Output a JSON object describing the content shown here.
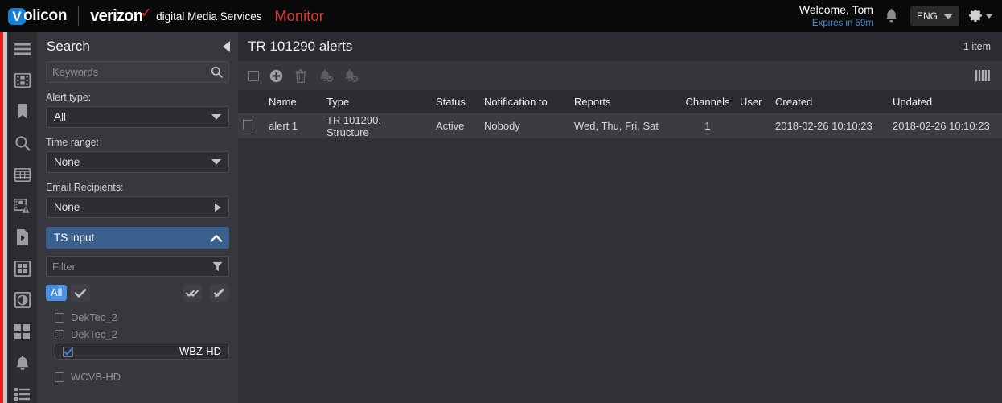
{
  "topbar": {
    "logo_letter": "V",
    "logo_text": "olicon",
    "brand": "verizon",
    "brand_check": "✓",
    "brand_sub": "digital Media Services",
    "product": "Monitor",
    "welcome": "Welcome, Tom",
    "expires": "Expires in 59m",
    "language": "ENG",
    "bell_icon": "bell-icon",
    "gear_icon": "gear-icon",
    "caret_icon": "chevron-down-icon"
  },
  "rail": {
    "items": [
      {
        "icon": "hamburger-menu-icon",
        "name": "menu"
      },
      {
        "icon": "film-strip-icon",
        "name": "media"
      },
      {
        "icon": "bookmark-icon",
        "name": "bookmarks"
      },
      {
        "icon": "search-icon",
        "name": "search"
      },
      {
        "icon": "grid-table-icon",
        "name": "table"
      },
      {
        "icon": "film-alert-icon",
        "name": "media-alerts"
      },
      {
        "icon": "file-play-icon",
        "name": "clips"
      },
      {
        "icon": "layout-box-icon",
        "name": "layouts"
      },
      {
        "icon": "contrast-circle-icon",
        "name": "quality"
      },
      {
        "icon": "four-squares-icon",
        "name": "multiview"
      },
      {
        "icon": "bell-icon",
        "name": "alerts"
      },
      {
        "icon": "list-icon",
        "name": "reports"
      }
    ]
  },
  "search_panel": {
    "title": "Search",
    "collapse_icon": "collapse-left-icon",
    "keywords": {
      "value": "",
      "placeholder": "Keywords",
      "icon": "search-icon"
    },
    "alert_type": {
      "label": "Alert type:",
      "value": "All",
      "icon": "chevron-down-icon"
    },
    "time_range": {
      "label": "Time range:",
      "value": "None",
      "icon": "chevron-down-icon"
    },
    "email_recipients": {
      "label": "Email Recipients:",
      "value": "None",
      "icon": "chevron-right-icon"
    },
    "ts_input": {
      "title": "TS input",
      "collapse_icon": "chevron-up-icon",
      "filter": {
        "value": "",
        "placeholder": "Filter",
        "icon": "funnel-icon"
      },
      "all_badge": "All",
      "check_icon": "check-icon",
      "select_all_icon": "double-check-icon",
      "clear_all_icon": "check-slash-icon",
      "items": [
        {
          "label": "DekTec_2",
          "checked": false
        },
        {
          "label": "DekTec_2",
          "checked": false
        },
        {
          "label": "WBZ-HD",
          "checked": true
        },
        {
          "label": "WCVB-HD",
          "checked": false
        }
      ]
    }
  },
  "main": {
    "title": "TR 101290 alerts",
    "item_count": "1 item",
    "toolbar": {
      "select_all_icon": "checkbox-icon",
      "add_icon": "plus-circle-icon",
      "delete_icon": "trash-icon",
      "enable_alert_icon": "bell-check-icon",
      "disable_alert_icon": "bell-x-icon",
      "columns_icon": "columns-icon"
    },
    "table": {
      "columns": [
        "",
        "Name",
        "Type",
        "Status",
        "Notification to",
        "Reports",
        "Channels",
        "User",
        "Created",
        "Updated"
      ],
      "rows": [
        {
          "name": "alert 1",
          "type": "TR 101290, Structure",
          "status": "Active",
          "notification_to": "Nobody",
          "reports": "Wed, Thu, Fri, Sat",
          "channels": "1",
          "user": "",
          "created": "2018-02-26 10:10:23",
          "updated": "2018-02-26 10:10:23"
        }
      ]
    }
  },
  "colors": {
    "accent_red": "#e02020",
    "brand_blue": "#4a90e2",
    "panel_blue": "#3a6090",
    "link_blue": "#4a8fd4",
    "monitor_red": "#e03a2f"
  }
}
